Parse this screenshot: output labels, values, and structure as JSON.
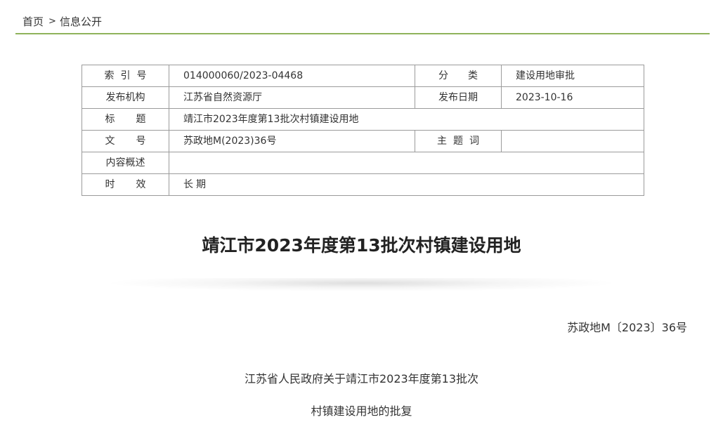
{
  "breadcrumb": {
    "home": "首页",
    "separator": ">",
    "current": "信息公开"
  },
  "meta": {
    "index_label": "索引号",
    "index_value": "014000060/2023-04468",
    "category_label": "分类",
    "category_value": "建设用地审批",
    "publisher_label": "发布机构",
    "publisher_value": "江苏省自然资源厅",
    "date_label": "发布日期",
    "date_value": "2023-10-16",
    "title_label": "标题",
    "title_value": "靖江市2023年度第13批次村镇建设用地",
    "docno_label": "文号",
    "docno_value": "苏政地M(2023)36号",
    "keywords_label": "主题词",
    "keywords_value": "",
    "summary_label": "内容概述",
    "summary_value": "",
    "validity_label": "时效",
    "validity_value": "长期"
  },
  "article": {
    "title": "靖江市2023年度第13批次村镇建设用地",
    "doc_number": "苏政地M〔2023〕36号",
    "reply_line_1": "江苏省人民政府关于靖江市2023年度第13批次",
    "reply_line_2": "村镇建设用地的批复"
  }
}
